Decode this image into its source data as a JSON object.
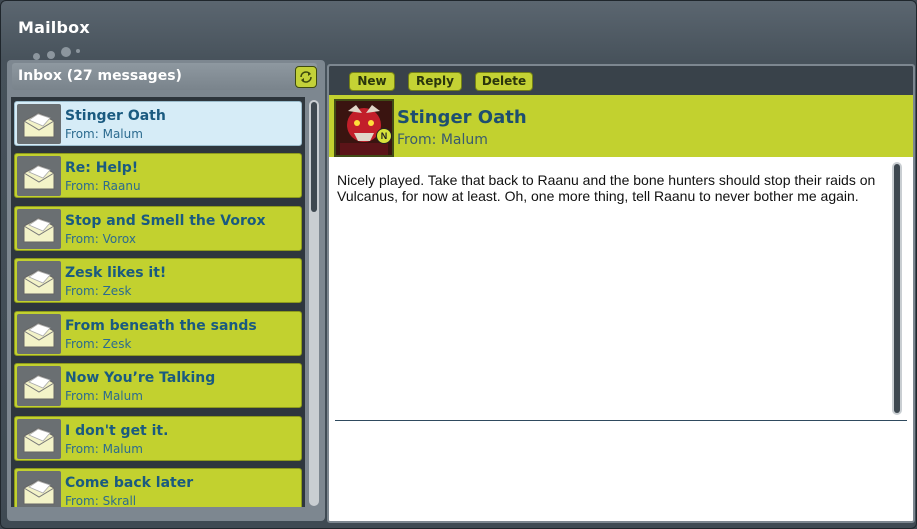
{
  "window": {
    "title": "Mailbox"
  },
  "inbox": {
    "title": "Inbox (27 messages)",
    "refresh_icon": "refresh-icon",
    "messages": [
      {
        "title": "Stinger Oath",
        "from": "From: Malum",
        "selected": true
      },
      {
        "title": "Re: Help!",
        "from": "From: Raanu",
        "selected": false
      },
      {
        "title": "Stop and Smell the Vorox",
        "from": "From: Vorox",
        "selected": false
      },
      {
        "title": "Zesk likes it!",
        "from": "From: Zesk",
        "selected": false
      },
      {
        "title": "From beneath the sands",
        "from": "From: Zesk",
        "selected": false
      },
      {
        "title": "Now You’re Talking",
        "from": "From: Malum",
        "selected": false
      },
      {
        "title": "I don't get it.",
        "from": "From: Malum",
        "selected": false
      },
      {
        "title": "Come back later",
        "from": "From: Skrall",
        "selected": false
      }
    ]
  },
  "toolbar": {
    "new_label": "New",
    "reply_label": "Reply",
    "delete_label": "Delete"
  },
  "message": {
    "title": "Stinger Oath",
    "from": "From: Malum",
    "badge": "N",
    "body": "Nicely played. Take that back to Raanu and the bone hunters should stop their raids on Vulcanus, for now at least. Oh, one more thing, tell Raanu to never bother me again."
  },
  "colors": {
    "accent": "#c2d12f",
    "selected": "#d6ecf7",
    "title_text": "#1a5a80",
    "panel": "#39424a"
  }
}
